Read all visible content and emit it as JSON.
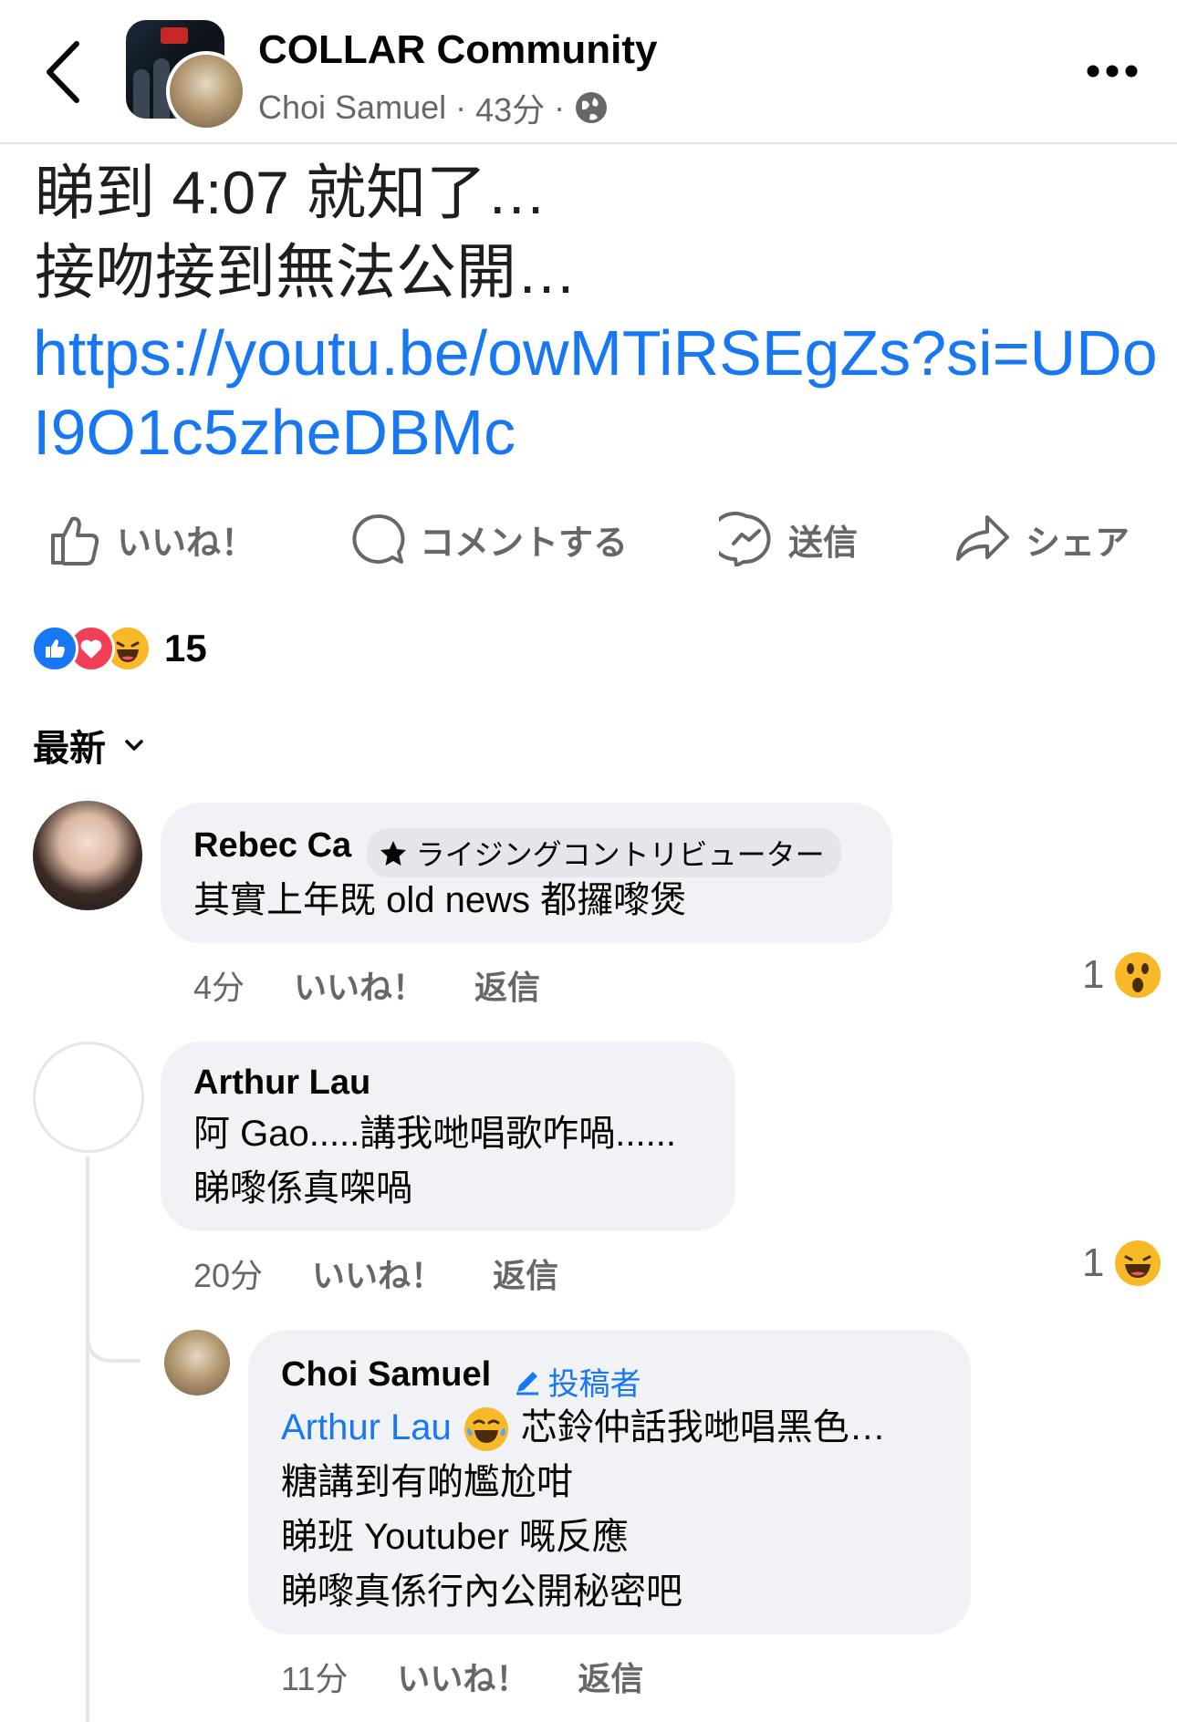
{
  "header": {
    "group_name": "COLLAR Community",
    "author": "Choi Samuel",
    "separator": "·",
    "time": "43分"
  },
  "post": {
    "line1": "睇到 4:07 就知了…",
    "line2": "接吻接到無法公開…",
    "link": "https://youtu.be/owMTiRSEgZs?si=UDoI9O1c5zheDBMc"
  },
  "actions": {
    "like": "いいね！",
    "comment": "コメントする",
    "send": "送信",
    "share": "シェア"
  },
  "reactions": {
    "count": "15",
    "types": [
      "like",
      "love",
      "haha"
    ]
  },
  "sort": {
    "label": "最新"
  },
  "comments": [
    {
      "name": "Rebec Ca",
      "badge": "ライジングコントリビューター",
      "lines": [
        "其實上年既 old news 都攞嚟煲"
      ],
      "time": "4分",
      "like": "いいね！",
      "reply": "返信",
      "reaction_count": "1",
      "reaction": "wow"
    },
    {
      "name": "Arthur Lau",
      "lines": [
        "阿 Gao.....講我哋唱歌咋喎......",
        "睇嚟係真㗎喎"
      ],
      "time": "20分",
      "like": "いいね！",
      "reply": "返信",
      "reaction_count": "1",
      "reaction": "haha"
    },
    {
      "name": "Choi Samuel",
      "badge": "投稿者",
      "mention": "Arthur Lau",
      "first_line_rest": "芯鈴仲話我哋唱黑色…",
      "lines": [
        "糖講到有啲尷尬咁",
        "睇班 Youtuber 嘅反應",
        "睇嚟真係行內公開秘密吧"
      ],
      "time": "11分",
      "like": "いいね！",
      "reply": "返信"
    }
  ],
  "colors": {
    "accent": "#1877f2",
    "secondary_text": "#65676b",
    "bubble": "#f0f2f5"
  }
}
